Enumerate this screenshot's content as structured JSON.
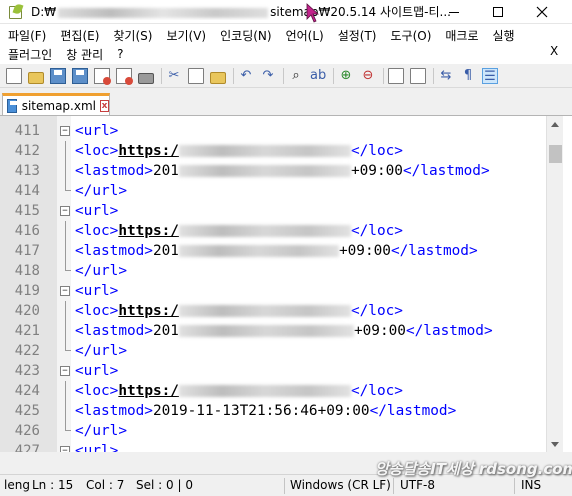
{
  "window": {
    "title_prefix": "D:₩",
    "title_suffix": "sitemap₩20.5.14 사이트맵-티..."
  },
  "menu": {
    "row1": [
      "파일(F)",
      "편집(E)",
      "찾기(S)",
      "보기(V)",
      "인코딩(N)",
      "언어(L)",
      "설정(T)",
      "도구(O)",
      "매크로",
      "실행"
    ],
    "row2": [
      "플러그인",
      "창 관리",
      "?"
    ],
    "close_label": "X"
  },
  "toolbar": {
    "icons": [
      "new-file-icon",
      "open-folder-icon",
      "save-icon",
      "save-all-icon",
      "close-icon",
      "close-all-icon",
      "print-icon",
      "cut-icon",
      "copy-icon",
      "paste-icon",
      "undo-icon",
      "redo-icon",
      "find-icon",
      "replace-icon",
      "zoom-in-icon",
      "zoom-out-icon",
      "sync-vertical-icon",
      "sync-horizontal-icon",
      "word-wrap-icon",
      "show-all-characters-icon",
      "indent-guide-icon"
    ]
  },
  "tab": {
    "label": "sitemap.xml",
    "close": "x"
  },
  "editor": {
    "lines": [
      {
        "num": "411",
        "kind": "url-open",
        "text": "<url>"
      },
      {
        "num": "412",
        "kind": "loc",
        "open": "<loc>",
        "value": "https:/",
        "close": "</loc>"
      },
      {
        "num": "413",
        "kind": "lastmod-blur",
        "open": "<lastmod>",
        "value_start": "201",
        "value_end": "+09:00",
        "close": "</lastmod>"
      },
      {
        "num": "414",
        "kind": "url-close",
        "text": "</url>"
      },
      {
        "num": "415",
        "kind": "url-open",
        "text": "<url>"
      },
      {
        "num": "416",
        "kind": "loc",
        "open": "<loc>",
        "value": "https:/",
        "close": "</loc>"
      },
      {
        "num": "417",
        "kind": "lastmod-blur",
        "open": "<lastmod>",
        "value_start": "201",
        "value_end": "+09:00",
        "close": "</lastmod>"
      },
      {
        "num": "418",
        "kind": "url-close",
        "text": "</url>"
      },
      {
        "num": "419",
        "kind": "url-open",
        "text": "<url>"
      },
      {
        "num": "420",
        "kind": "loc",
        "open": "<loc>",
        "value": "https:/",
        "close": "</loc>"
      },
      {
        "num": "421",
        "kind": "lastmod-blur",
        "open": "<lastmod>",
        "value_start": "201",
        "value_end": "+09:00",
        "close": "</lastmod>"
      },
      {
        "num": "422",
        "kind": "url-close",
        "text": "</url>"
      },
      {
        "num": "423",
        "kind": "url-open",
        "text": "<url>"
      },
      {
        "num": "424",
        "kind": "loc",
        "open": "<loc>",
        "value": "https:/",
        "close": "</loc>"
      },
      {
        "num": "425",
        "kind": "lastmod",
        "open": "<lastmod>",
        "value": "2019-11-13T21:56:46+09:00",
        "close": "</lastmod>"
      },
      {
        "num": "426",
        "kind": "url-close",
        "text": "</url>"
      },
      {
        "num": "427",
        "kind": "url-open",
        "text": "<url>"
      }
    ]
  },
  "status": {
    "length": "leng",
    "line": "Ln : 15",
    "col": "Col : 7",
    "sel": "Sel : 0 | 0",
    "eol": "Windows (CR LF)",
    "encoding": "UTF-8",
    "mode": "INS"
  },
  "watermark": "앙송달송IT세상 rdsong.com"
}
